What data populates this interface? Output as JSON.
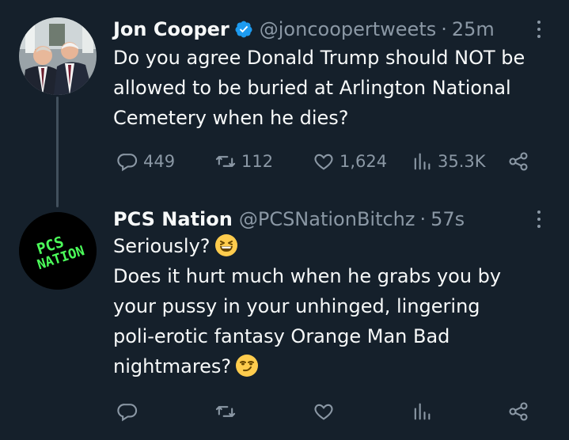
{
  "tweets": [
    {
      "author_name": "Jon Cooper",
      "verified": true,
      "handle": "@joncoopertweets",
      "dot": "·",
      "time": "25m",
      "body_lines": [
        "Do you agree Donald Trump should NOT be",
        "allowed to be buried at Arlington National",
        "Cemetery when he dies?"
      ],
      "replies": "449",
      "retweets": "112",
      "likes": "1,624",
      "views": "35.3K"
    },
    {
      "author_name": "PCS Nation",
      "verified": false,
      "handle": "@PCSNationBitchz",
      "dot": "·",
      "time": "57s",
      "avatar_text": [
        "PCS",
        "NATION"
      ],
      "body_lines": [
        "Seriously?",
        "Does it hurt much when he grabs you by",
        "your pussy in your unhinged, lingering",
        "poli-erotic fantasy Orange Man Bad",
        "nightmares?"
      ],
      "emojis": [
        "grinning-squinting-face",
        "smirking-face"
      ],
      "replies": "",
      "retweets": "",
      "likes": "",
      "views": ""
    }
  ],
  "colors": {
    "background": "#15202b",
    "text": "#f7f9f9",
    "muted": "#8b98a5",
    "verified": "#1d9bf0",
    "avatar_text": "#4cff5a"
  }
}
